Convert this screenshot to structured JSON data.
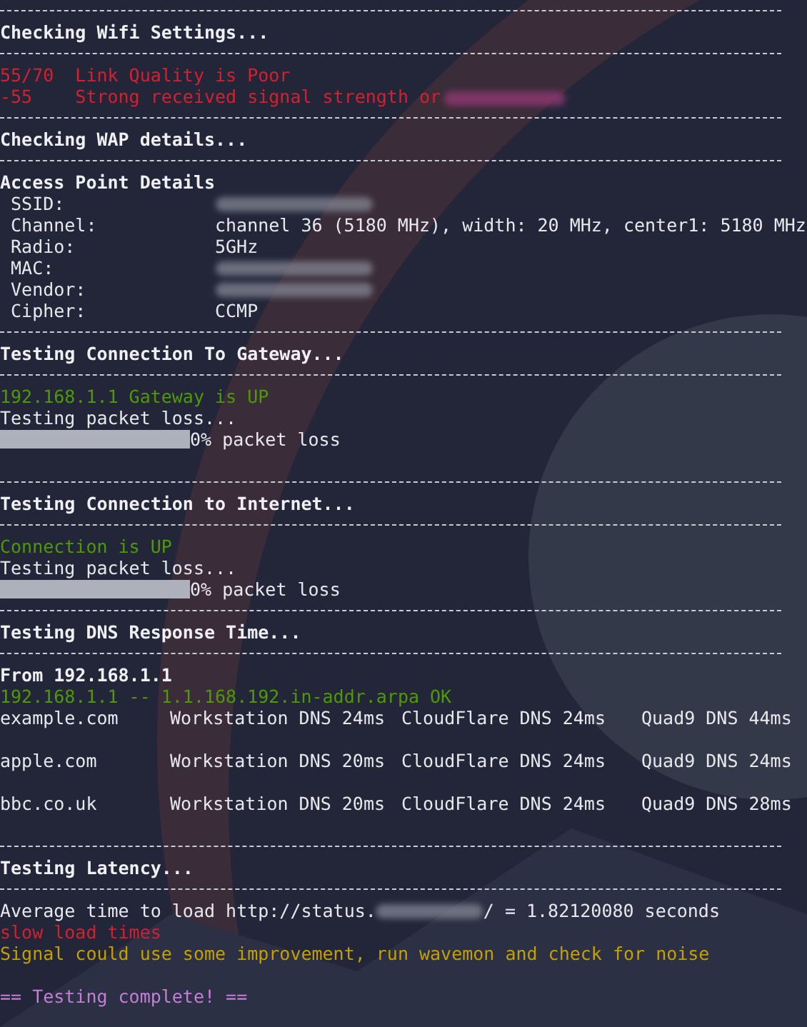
{
  "lines": [
    {
      "kind": "rule"
    },
    {
      "kind": "heading",
      "text": "Checking Wifi Settings..."
    },
    {
      "kind": "rule"
    },
    {
      "kind": "text",
      "text": "55/70  Link Quality is Poor",
      "color": "#d5202e"
    },
    {
      "kind": "text",
      "text": "-55    Strong received signal strength or",
      "color": "#d5202e",
      "redacted_after": true
    },
    {
      "kind": "rule"
    },
    {
      "kind": "heading",
      "text": "Checking WAP details..."
    },
    {
      "kind": "rule"
    },
    {
      "kind": "heading",
      "text": "Access Point Details"
    },
    {
      "kind": "field",
      "label": "SSID:",
      "redacted": true
    },
    {
      "kind": "field",
      "label": "Channel:",
      "value": "channel 36 (5180 MHz), width: 20 MHz, center1: 5180 MHz"
    },
    {
      "kind": "field",
      "label": "Radio:",
      "value": "5GHz"
    },
    {
      "kind": "field",
      "label": "MAC:",
      "redacted": true
    },
    {
      "kind": "field",
      "label": "Vendor:",
      "redacted": true
    },
    {
      "kind": "field",
      "label": "Cipher:",
      "value": "CCMP"
    },
    {
      "kind": "rule"
    },
    {
      "kind": "heading",
      "text": "Testing Connection To Gateway..."
    },
    {
      "kind": "rule"
    },
    {
      "kind": "text",
      "text": "192.168.1.1 Gateway is UP",
      "color": "#4e9a06"
    },
    {
      "kind": "text",
      "text": "Testing packet loss...",
      "color": "#e8e8ec"
    },
    {
      "kind": "progress",
      "level": 1,
      "reading": "0% packet loss"
    },
    {
      "kind": "blank"
    },
    {
      "kind": "rule"
    },
    {
      "kind": "heading",
      "text": "Testing Connection to Internet..."
    },
    {
      "kind": "rule"
    },
    {
      "kind": "text",
      "text": "Connection is UP",
      "color": "#4e9a06"
    },
    {
      "kind": "text",
      "text": "Testing packet loss...",
      "color": "#e8e8ec"
    },
    {
      "kind": "progress",
      "level": 1,
      "reading": "0% packet loss"
    },
    {
      "kind": "rule"
    },
    {
      "kind": "heading",
      "text": "Testing DNS Response Time..."
    },
    {
      "kind": "rule"
    },
    {
      "kind": "heading",
      "text": "From 192.168.1.1"
    },
    {
      "kind": "text",
      "text": "192.168.1.1 -- 1.1.168.192.in-addr.arpa OK",
      "color": "#4e9a06"
    },
    {
      "kind": "dns",
      "host": "example.com",
      "workstation": "Workstation DNS 24ms",
      "cloudflare": "CloudFlare DNS 24ms",
      "quad9": "Quad9 DNS 44ms"
    },
    {
      "kind": "blank"
    },
    {
      "kind": "dns",
      "host": "apple.com",
      "workstation": "Workstation DNS 20ms",
      "cloudflare": "CloudFlare DNS 24ms",
      "quad9": "Quad9 DNS 24ms"
    },
    {
      "kind": "blank"
    },
    {
      "kind": "dns",
      "host": "bbc.co.uk",
      "workstation": "Workstation DNS 20ms",
      "cloudflare": "CloudFlare DNS 24ms",
      "quad9": "Quad9 DNS 28ms"
    },
    {
      "kind": "blank"
    },
    {
      "kind": "rule"
    },
    {
      "kind": "heading",
      "text": "Testing Latency..."
    },
    {
      "kind": "rule"
    },
    {
      "kind": "latency",
      "before": "Average time to load http://status.",
      "after": "/ = 1.82120080 seconds"
    },
    {
      "kind": "text",
      "text": "slow load times",
      "color": "#d5202e"
    },
    {
      "kind": "text",
      "text": "Signal could use some improvement, run wavemon and check for noise",
      "color": "#c4a000"
    },
    {
      "kind": "blank"
    },
    {
      "kind": "text",
      "text": "== Testing complete! ==",
      "color": "#c77dd6"
    }
  ]
}
